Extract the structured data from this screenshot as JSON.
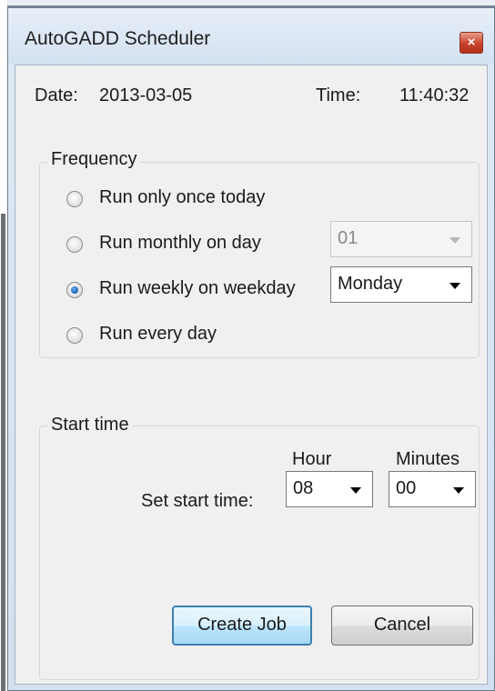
{
  "window": {
    "title": "AutoGADD Scheduler",
    "close_glyph": "×"
  },
  "header": {
    "date_label": "Date:",
    "date_value": "2013-03-05",
    "time_label": "Time:",
    "time_value": "11:40:32"
  },
  "frequency": {
    "legend": "Frequency",
    "options": [
      {
        "label": "Run only once today",
        "checked": false
      },
      {
        "label": "Run monthly on day",
        "checked": false
      },
      {
        "label": "Run weekly on weekday",
        "checked": true
      },
      {
        "label": "Run every day",
        "checked": false
      }
    ],
    "monthly_day": {
      "value": "01",
      "enabled": false
    },
    "weekday": {
      "value": "Monday",
      "enabled": true
    }
  },
  "start_time": {
    "legend": "Start time",
    "hour_header": "Hour",
    "minutes_header": "Minutes",
    "set_label": "Set start time:",
    "hour_value": "08",
    "minutes_value": "00"
  },
  "actions": {
    "create_label": "Create Job",
    "cancel_label": "Cancel"
  },
  "icons": {
    "close": "close-icon",
    "dropdown": "chevron-down-icon"
  }
}
